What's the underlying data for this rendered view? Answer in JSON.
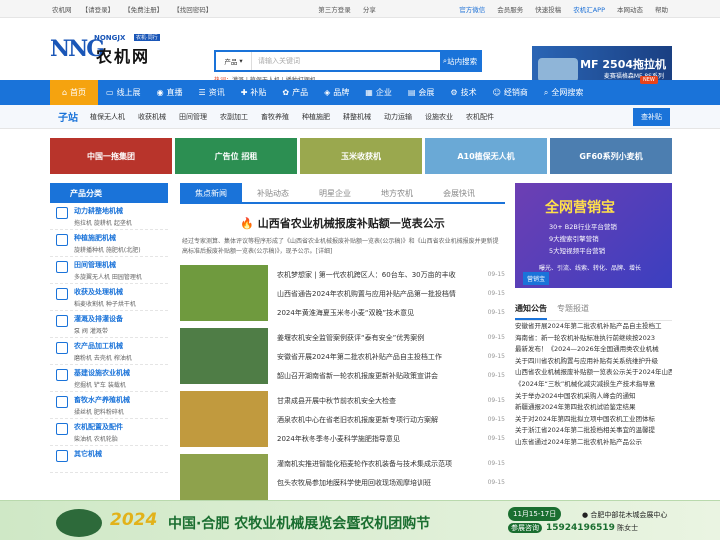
{
  "topbar": {
    "site": "农机网",
    "login": "【请登录】",
    "register": "【免费注册】",
    "forgot": "【找回密码】",
    "third_login": "第三方登录",
    "share": "分享",
    "wechat": "官方微信",
    "vip": "会员服务",
    "quick": "快速投稿",
    "app": "农机汇APP",
    "site_map": "本网动态",
    "help": "帮助"
  },
  "logo": {
    "en": "NONGJX",
    "tag": "农机·同行",
    "cn": "农机网"
  },
  "search": {
    "category": "产品",
    "placeholder": "请输入关键词",
    "button": "站内搜索",
    "hot_label": "热词：",
    "hot": "灌溉 | 植保无人机 | 播种打捆机"
  },
  "header_ad": {
    "title": "MF 2504拖拉机",
    "sub": "麦赛福格森MF 8S系列"
  },
  "nav": [
    {
      "label": "首页",
      "icon": "home-icon",
      "sym": "⌂"
    },
    {
      "label": "线上展",
      "icon": "screen-icon",
      "sym": "▭"
    },
    {
      "label": "直播",
      "icon": "live-icon",
      "sym": "◉"
    },
    {
      "label": "资讯",
      "icon": "news-icon",
      "sym": "☰"
    },
    {
      "label": "补贴",
      "icon": "plus-icon",
      "sym": "✚"
    },
    {
      "label": "产品",
      "icon": "product-icon",
      "sym": "✿"
    },
    {
      "label": "品牌",
      "icon": "brand-icon",
      "sym": "◈"
    },
    {
      "label": "企业",
      "icon": "company-icon",
      "sym": "▦"
    },
    {
      "label": "会展",
      "icon": "expo-icon",
      "sym": "▤"
    },
    {
      "label": "技术",
      "icon": "tech-icon",
      "sym": "⚙"
    },
    {
      "label": "经销商",
      "icon": "dealer-icon",
      "sym": "☺"
    },
    {
      "label": "全网搜索",
      "icon": "search-icon",
      "sym": "⌕"
    }
  ],
  "nav_new": "NEW",
  "subnav": {
    "head": "子站",
    "items": [
      "植保无人机",
      "收获机械",
      "田间管理",
      "农副加工",
      "畜牧养殖",
      "种植施肥",
      "耕整机械",
      "动力运输",
      "设施农业",
      "农机配件"
    ],
    "button": "查补贴"
  },
  "banners": [
    {
      "text": "中国一拖集团",
      "color": "#b8342b"
    },
    {
      "text": "广告位 招租",
      "color": "#2c8f52"
    },
    {
      "text": "玉米收获机",
      "color": "#9aa84e"
    },
    {
      "text": "A10植保无人机",
      "color": "#6aa9d6"
    },
    {
      "text": "GF60系列小麦机",
      "color": "#4c7eb0"
    }
  ],
  "sidebar": {
    "head": "产品分类",
    "items": [
      {
        "title": "动力耕整地机械",
        "sub": "拖拉机 旋耕机 起垄机"
      },
      {
        "title": "种植施肥机械",
        "sub": "旋耕播种机 施肥机(北肥)"
      },
      {
        "title": "田间管理机械",
        "sub": "多旋翼无人机 田园管理机"
      },
      {
        "title": "收获及处理机械",
        "sub": "稻麦收割机 种子烘干机"
      },
      {
        "title": "灌溉及排灌设备",
        "sub": "泵 阀 灌溉带"
      },
      {
        "title": "农产品加工机械",
        "sub": "磨粉机 去壳机 榨油机"
      },
      {
        "title": "基建设施农业机械",
        "sub": "挖掘机 铲车 装载机"
      },
      {
        "title": "畜牧水产养殖机械",
        "sub": "揉丝机 肥料粉碎机"
      },
      {
        "title": "农机配置及配件",
        "sub": "柴油机 农机轮胎"
      },
      {
        "title": "其它机械",
        "sub": ""
      }
    ]
  },
  "center": {
    "tabs": [
      "焦点新闻",
      "补贴动态",
      "明星企业",
      "地方农机",
      "会展快讯"
    ],
    "headline": "山西省农业机械报废补贴额一览表公示",
    "summary": "经过专家测算、集体评议等程序形成了《山西省农业机械报废补贴额一览表(公示稿)》和《山西省农业机械报废并更新提高标准后报废补贴额一览表(公示稿)》，现予公示。[详细]",
    "groups": [
      {
        "img": "#6f9a3e",
        "rows": [
          {
            "t": "农机梦想家 | 第一代农机跨区人：60台车、30万亩的丰收",
            "d": "09-15"
          },
          {
            "t": "山西省通告2024年农机购置与应用补贴产品第一批投档情",
            "d": "09-15"
          },
          {
            "t": "2024年黄淮海夏玉米冬小麦“双晚”技术意见",
            "d": "09-15"
          }
        ]
      },
      {
        "img": "#4f7d46",
        "rows": [
          {
            "t": "姜堰农机安全监管案例获评“泰有安全”优秀案例",
            "d": "09-15"
          },
          {
            "t": "安徽省开展2024年第二批农机补贴产品自主投档工作",
            "d": "09-15"
          },
          {
            "t": "韶山召开湖南省新一轮农机报废更新补贴政策宣讲会",
            "d": "09-15"
          }
        ]
      },
      {
        "img": "#c19a3e",
        "rows": [
          {
            "t": "甘肃成县开展中秋节前农机安全大检查",
            "d": "09-15"
          },
          {
            "t": "酒泉农机中心在省老旧农机报废更新专项行动方案解",
            "d": "09-15"
          },
          {
            "t": "2024年秋冬季冬小麦科学施肥指导意见",
            "d": "09-15"
          }
        ]
      },
      {
        "img": "#8ea24c",
        "rows": [
          {
            "t": "灌南机实推进智能化稻麦轮作农机装备与技术集成示范项",
            "d": "09-15"
          },
          {
            "t": "包头农牧局参加地膜科学使用回收现场观摩培训班",
            "d": "09-15"
          }
        ]
      }
    ]
  },
  "right": {
    "ad": {
      "big": "全网营销宝",
      "l1": "30+ B2B行业平台营销",
      "l2": "9大搜索引擎营销",
      "l3": "5大短视频平台营销",
      "l4": "曝光、引流、线索、转化、品牌、增长",
      "button": "营销宝"
    },
    "tabs": [
      "通知公告",
      "专题报道"
    ],
    "notices": [
      "安徽省开展2024年第二批农机补贴产品自主投档工",
      "海南省：新一轮农机补贴标准执行前继续按2023",
      "最新发布！《2024—2026年全国通用类农业机械",
      "关于四川省农机购置与应用补贴有关系统维护升级",
      "山西省农业机械报废补贴额一览表公示关于2024年山西省",
      "《2024年“三秋”机械化减灾减损生产技术指导意",
      "关于举办2024中国农机采购人峰会的通知",
      "新疆通报2024年第四批农机试验鉴定结果",
      "关于对2024年第四批拟立项中国农机工业团体标",
      "关于浙江省2024年第二批投档相关事宜的温馨提",
      "山东省通过2024年第二批农机补贴产品公示"
    ]
  },
  "bottom": {
    "year": "2024",
    "title": "中国·合肥 农牧业机械展览会暨农机团购节",
    "date": "11月15-17日",
    "loc": "合肥中部花木城会展中心",
    "tel_label": "参展咨询",
    "tel": "15924196519",
    "contact": "陈女士"
  }
}
